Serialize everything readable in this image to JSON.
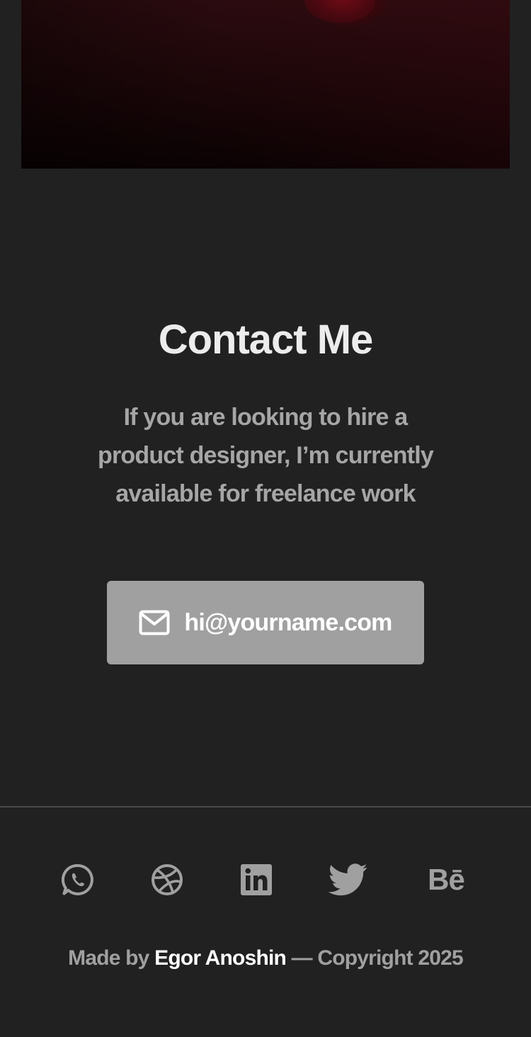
{
  "contact": {
    "title": "Contact Me",
    "description": "If you are looking to hire a product designer, I’m currently available for freelance work",
    "email_label": "hi@yourname.com",
    "email_icon": "mail-icon"
  },
  "social": [
    {
      "name": "whatsapp",
      "icon": "whatsapp-icon"
    },
    {
      "name": "dribbble",
      "icon": "dribbble-icon"
    },
    {
      "name": "linkedin",
      "icon": "linkedin-icon"
    },
    {
      "name": "twitter",
      "icon": "twitter-icon"
    },
    {
      "name": "behance",
      "icon": "behance-icon",
      "glyph": "Bē"
    }
  ],
  "footer": {
    "prefix": "Made by ",
    "author": "Egor Anoshin",
    "suffix": " — Copyright 2025"
  },
  "colors": {
    "background": "#212121",
    "button": "#a0a0a0",
    "title": "#ececec",
    "muted_text": "#a6a6a6",
    "icon": "#a0a0a0"
  }
}
